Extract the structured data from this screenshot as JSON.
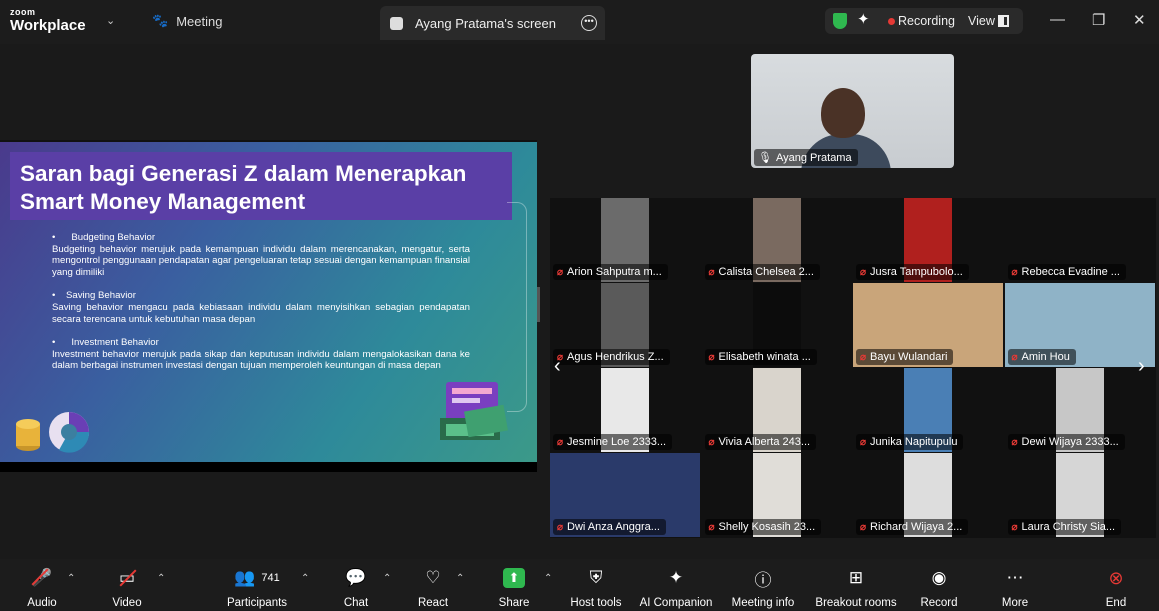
{
  "titlebar": {
    "logo_top": "zoom",
    "logo_bottom": "Workplace",
    "meeting_label": "Meeting",
    "screen_tab_label": "Ayang Pratama's screen",
    "recording_label": "Recording",
    "view_label": "View"
  },
  "slide": {
    "title": "Saran bagi Generasi Z dalam Menerapkan Smart Money Management",
    "sections": [
      {
        "heading": "•      Budgeting Behavior",
        "text": "Budgeting behavior merujuk pada kemampuan individu dalam merencanakan, mengatur, serta mengontrol penggunaan pendapatan agar pengeluaran tetap sesuai dengan kemampuan finansial yang dimiliki"
      },
      {
        "heading": "•    Saving Behavior",
        "text": "Saving behavior mengacu pada kebiasaan individu dalam menyisihkan sebagian pendapatan secara terencana untuk kebutuhan masa depan"
      },
      {
        "heading": "•      Investment Behavior",
        "text": "Investment behavior merujuk pada sikap dan keputusan individu dalam mengalokasikan dana ke dalam berbagai instrumen investasi dengan tujuan memperoleh keuntungan di masa depan"
      }
    ]
  },
  "speaker": {
    "name": "Ayang Pratama"
  },
  "participants": [
    {
      "name": "Arion Sahputra m...",
      "color": "#6b6b6b"
    },
    {
      "name": "Calista Chelsea 2...",
      "color": "#7a6a60"
    },
    {
      "name": "Jusra Tampubolo...",
      "color": "#b0201e"
    },
    {
      "name": "Rebecca Evadine ...",
      "color": "#111111"
    },
    {
      "name": "Agus Hendrikus Z...",
      "color": "#5a5a5a"
    },
    {
      "name": "Elisabeth winata ...",
      "color": "#0c0c0c"
    },
    {
      "name": "Bayu Wulandari",
      "color": "#c9a57a"
    },
    {
      "name": "Amin Hou",
      "color": "#8fb3c7"
    },
    {
      "name": "Jesmine Loe 2333...",
      "color": "#e8e8e8"
    },
    {
      "name": "Vivia Alberta 243...",
      "color": "#d9d4cc"
    },
    {
      "name": "Junika Napitupulu",
      "color": "#4a7fb5"
    },
    {
      "name": "Dewi Wijaya 2333...",
      "color": "#c7c7c7"
    },
    {
      "name": "Dwi Anza Anggra...",
      "color": "#2a3a6a"
    },
    {
      "name": "Shelly Kosasih 23...",
      "color": "#e0ddd8"
    },
    {
      "name": "Richard Wijaya 2...",
      "color": "#dddddd"
    },
    {
      "name": "Laura Christy Sia...",
      "color": "#d6d6d6"
    }
  ],
  "toolbar": {
    "audio": "Audio",
    "video": "Video",
    "participants": "Participants",
    "participant_count": "741",
    "chat": "Chat",
    "react": "React",
    "share": "Share",
    "host_tools": "Host tools",
    "ai_companion": "AI Companion",
    "meeting_info": "Meeting info",
    "breakout_rooms": "Breakout rooms",
    "record": "Record",
    "more": "More",
    "end": "End"
  },
  "colors": {
    "recording": "#e53935",
    "share": "#2fb84f",
    "end": "#e53935",
    "shield": "#2fb84f"
  }
}
